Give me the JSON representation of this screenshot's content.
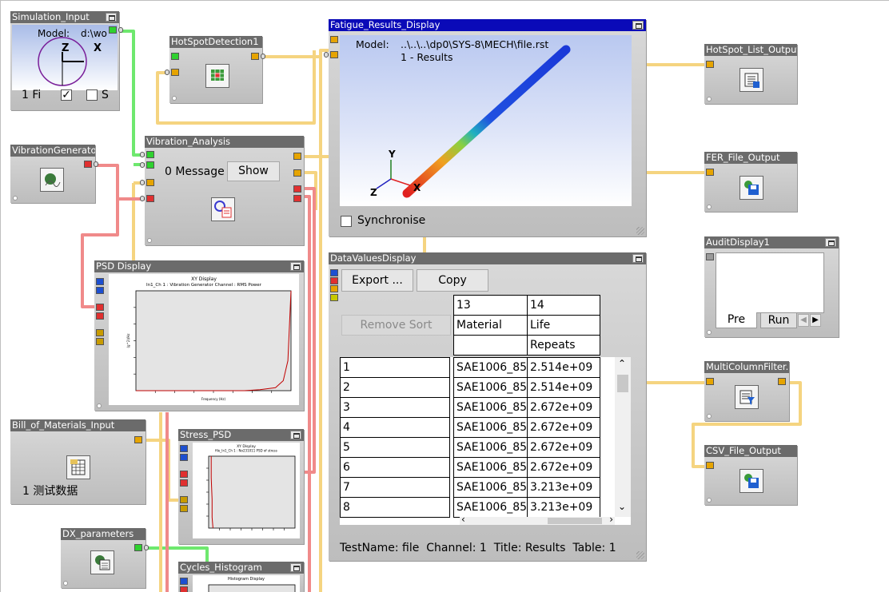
{
  "colors": {
    "wire_orange": "#f5d480",
    "wire_red": "#f08a8a",
    "wire_green": "#6ee86e",
    "title_inactive": "#6b6b6b",
    "title_active": "#0a0ab8"
  },
  "simulation_input": {
    "title": "Simulation_Input",
    "model_label": "Model:",
    "model_path": "d:\\wo",
    "axis_z": "Z",
    "axis_x": "X",
    "count_text": "1 Fi",
    "checkbox_label": "S"
  },
  "hotspot_detection": {
    "title": "HotSpotDetection1",
    "icon": "hotspot-grid-icon"
  },
  "vibration_generator": {
    "title": "VibrationGenerato",
    "icon": "vibration-wave-icon"
  },
  "vibration_analysis": {
    "title": "Vibration_Analysis",
    "messages": "0 Message",
    "show_label": "Show",
    "icon": "vibration-analysis-icon"
  },
  "psd_display": {
    "title": "PSD Display"
  },
  "bill_of_materials": {
    "title": "Bill_of_Materials_Input",
    "status": "1 测试数据",
    "icon": "table-sheet-icon"
  },
  "stress_psd": {
    "title": "Stress_PSD"
  },
  "dx_parameters": {
    "title": "DX_parameters",
    "icon": "parameters-icon"
  },
  "cycles_histogram": {
    "title": "Cycles_Histogram"
  },
  "fatigue_results": {
    "title": "Fatigue_Results_Display",
    "model_label": "Model:",
    "model_path": "..\\..\\..\\dp0\\SYS-8\\MECH\\file.rst",
    "results_label": "1 - Results",
    "axis_y": "Y",
    "axis_x": "X",
    "axis_z": "Z",
    "synchronise_label": "Synchronise"
  },
  "data_values": {
    "title": "DataValuesDisplay",
    "export_label": "Export ...",
    "copy_label": "Copy",
    "remove_sort_label": "Remove Sort",
    "col_numbers": [
      "13",
      "14"
    ],
    "col_names": [
      "Material",
      "Life"
    ],
    "col_sub": [
      "",
      "Repeats"
    ],
    "rows": [
      {
        "n": "1",
        "material": "SAE1006_85",
        "life": "2.514e+09"
      },
      {
        "n": "2",
        "material": "SAE1006_85",
        "life": "2.514e+09"
      },
      {
        "n": "3",
        "material": "SAE1006_85",
        "life": "2.672e+09"
      },
      {
        "n": "4",
        "material": "SAE1006_85",
        "life": "2.672e+09"
      },
      {
        "n": "5",
        "material": "SAE1006_85",
        "life": "2.672e+09"
      },
      {
        "n": "6",
        "material": "SAE1006_85",
        "life": "2.672e+09"
      },
      {
        "n": "7",
        "material": "SAE1006_85",
        "life": "3.213e+09"
      },
      {
        "n": "8",
        "material": "SAE1006_85",
        "life": "3.213e+09"
      }
    ],
    "status": "TestName: file  Channel: 1  Title: Results  Table: 1"
  },
  "hotspot_list_output": {
    "title": "HotSpot_List_Output",
    "icon": "list-save-icon"
  },
  "fer_file_output": {
    "title": "FER_File_Output",
    "icon": "file-save-icon"
  },
  "audit_display": {
    "title": "AuditDisplay1",
    "tab_pre": "Pre",
    "tab_run": "Run"
  },
  "multicolumn_filter": {
    "title": "MultiColumnFilter.",
    "icon": "filter-icon"
  },
  "csv_file_output": {
    "title": "CSV_File_Output",
    "icon": "csv-save-icon"
  },
  "chart_data": [
    {
      "type": "line",
      "title": "XY Display",
      "subtitle": "In1_Ch 1 : Vibration Generator Channel : RMS Power",
      "xlabel": "Frequency (Hz)",
      "ylabel": "(g^2)/Hz",
      "series": [
        {
          "x": [
            0,
            0.1,
            0.2,
            0.3,
            0.4,
            0.5,
            0.6,
            0.7,
            0.8,
            0.9,
            0.95,
            0.98,
            1.0
          ],
          "y": [
            0,
            0,
            0,
            0,
            0,
            0,
            0,
            0,
            0.01,
            0.03,
            0.1,
            0.3,
            1.0
          ]
        }
      ]
    },
    {
      "type": "line",
      "title": "XY Display",
      "subtitle": "file_In1_Ch 1 : No231011 PSD of stress",
      "series": [
        {
          "x": [
            0.03,
            0.03,
            0.04,
            0.04,
            0.05
          ],
          "y": [
            1.0,
            0.7,
            0.4,
            0.15,
            0.0
          ]
        }
      ]
    },
    {
      "type": "bar",
      "title": "Histogram Display"
    }
  ]
}
